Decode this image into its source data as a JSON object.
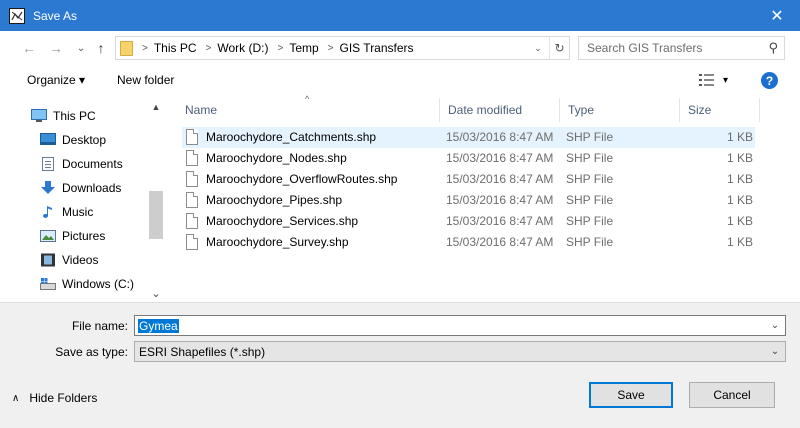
{
  "window": {
    "title": "Save As",
    "close_glyph": "✕"
  },
  "nav_buttons": {
    "back": "←",
    "forward": "→",
    "dropdown": "⌄",
    "up": "↑"
  },
  "address": {
    "crumbs": [
      "This PC",
      "Work (D:)",
      "Temp",
      "GIS Transfers"
    ],
    "dropdown": "⌄",
    "refresh": "↻"
  },
  "search": {
    "placeholder": "Search GIS Transfers",
    "icon": "⚲"
  },
  "toolbar": {
    "organize": "Organize ▾",
    "new_folder": "New folder",
    "view_drop": "▾",
    "help": "?"
  },
  "nav_pane": {
    "items": [
      {
        "label": "This PC",
        "icon": "computer-icon"
      },
      {
        "label": "Desktop",
        "icon": "desktop-icon"
      },
      {
        "label": "Documents",
        "icon": "documents-icon"
      },
      {
        "label": "Downloads",
        "icon": "downloads-icon"
      },
      {
        "label": "Music",
        "icon": "music-icon"
      },
      {
        "label": "Pictures",
        "icon": "pictures-icon"
      },
      {
        "label": "Videos",
        "icon": "videos-icon"
      },
      {
        "label": "Windows (C:)",
        "icon": "drive-icon"
      }
    ],
    "scroll_up": "▲",
    "scroll_down": "⌄"
  },
  "columns": {
    "name": "Name",
    "date": "Date modified",
    "type": "Type",
    "size": "Size",
    "sort_arrow": "^"
  },
  "files": [
    {
      "name": "Maroochydore_Catchments.shp",
      "date": "15/03/2016 8:47 AM",
      "type": "SHP File",
      "size": "1 KB"
    },
    {
      "name": "Maroochydore_Nodes.shp",
      "date": "15/03/2016 8:47 AM",
      "type": "SHP File",
      "size": "1 KB"
    },
    {
      "name": "Maroochydore_OverflowRoutes.shp",
      "date": "15/03/2016 8:47 AM",
      "type": "SHP File",
      "size": "1 KB"
    },
    {
      "name": "Maroochydore_Pipes.shp",
      "date": "15/03/2016 8:47 AM",
      "type": "SHP File",
      "size": "1 KB"
    },
    {
      "name": "Maroochydore_Services.shp",
      "date": "15/03/2016 8:47 AM",
      "type": "SHP File",
      "size": "1 KB"
    },
    {
      "name": "Maroochydore_Survey.shp",
      "date": "15/03/2016 8:47 AM",
      "type": "SHP File",
      "size": "1 KB"
    }
  ],
  "form": {
    "filename_label": "File name:",
    "filename_value": "Gymea",
    "savetype_label": "Save as type:",
    "savetype_value": "ESRI Shapefiles (*.shp)",
    "dropdown": "⌄"
  },
  "footer": {
    "hide_folders": "Hide Folders",
    "hide_chev": "∧",
    "save": "Save",
    "cancel": "Cancel"
  },
  "colors": {
    "title_bar": "#2b79d0",
    "selection": "#e5f3ff",
    "accent": "#0078d7"
  }
}
